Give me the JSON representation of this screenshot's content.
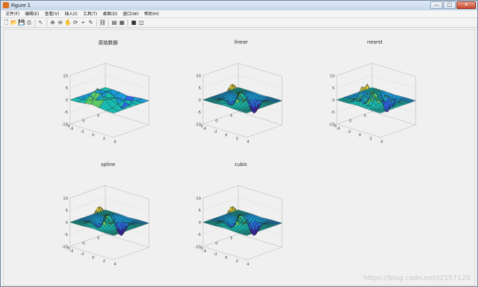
{
  "window": {
    "title": "Figure 1",
    "buttons": [
      "—",
      "□",
      "✕"
    ]
  },
  "menu": [
    "文件(F)",
    "编辑(E)",
    "查看(V)",
    "插入(I)",
    "工具(T)",
    "桌面(D)",
    "窗口(W)",
    "帮助(H)"
  ],
  "toolbar": {
    "icons": [
      "new-file-icon",
      "open-folder-icon",
      "save-icon",
      "print-icon",
      "pointer-icon",
      "zoom-in-icon",
      "zoom-out-icon",
      "pan-icon",
      "rotate-icon",
      "data-cursor-icon",
      "brush-icon",
      "link-icon",
      "colorbar-icon",
      "legend-icon",
      "hide-plot-tools-icon",
      "show-plot-tools-icon"
    ],
    "glyphs": [
      "🗋",
      "📂",
      "💾",
      "⎙",
      "↖",
      "⊕",
      "⊖",
      "✋",
      "⟳",
      "⌖",
      "✎",
      "⛓",
      "▤",
      "▦",
      "■",
      "◫"
    ]
  },
  "plots": [
    {
      "title": "原始数据",
      "method": "original",
      "z_ticks": [
        "10",
        "5",
        "0",
        "-5",
        "-10"
      ],
      "y_ticks": [
        "5",
        "0",
        "-5"
      ],
      "x_ticks": [
        "-4",
        "-2",
        "0",
        "2",
        "4"
      ]
    },
    {
      "title": "linear",
      "method": "linear",
      "z_ticks": [
        "10",
        "5",
        "0",
        "-5",
        "-10"
      ],
      "y_ticks": [
        "5",
        "0",
        "-5"
      ],
      "x_ticks": [
        "-4",
        "-2",
        "0",
        "2",
        "4"
      ]
    },
    {
      "title": "nearst",
      "method": "nearest",
      "z_ticks": [
        "10",
        "5",
        "0",
        "-5",
        "-10"
      ],
      "y_ticks": [
        "5",
        "0",
        "-5"
      ],
      "x_ticks": [
        "-4",
        "-2",
        "0",
        "2",
        "4"
      ]
    },
    {
      "title": "spline",
      "method": "spline",
      "z_ticks": [
        "10",
        "5",
        "0",
        "-5",
        "-10"
      ],
      "y_ticks": [
        "5",
        "0",
        "-5"
      ],
      "x_ticks": [
        "-4",
        "-2",
        "0",
        "2",
        "4"
      ]
    },
    {
      "title": "cubic",
      "method": "cubic",
      "z_ticks": [
        "10",
        "5",
        "0",
        "-5",
        "-10"
      ],
      "y_ticks": [
        "5",
        "0",
        "-5"
      ],
      "x_ticks": [
        "-4",
        "-2",
        "0",
        "2",
        "4"
      ]
    }
  ],
  "colormap": [
    "#3e26a8",
    "#2f64e6",
    "#1a9ad8",
    "#19bbb0",
    "#5dc963",
    "#c4c23a",
    "#f4d13a"
  ],
  "watermark": "https://blog.csdn.net/l2157120"
}
